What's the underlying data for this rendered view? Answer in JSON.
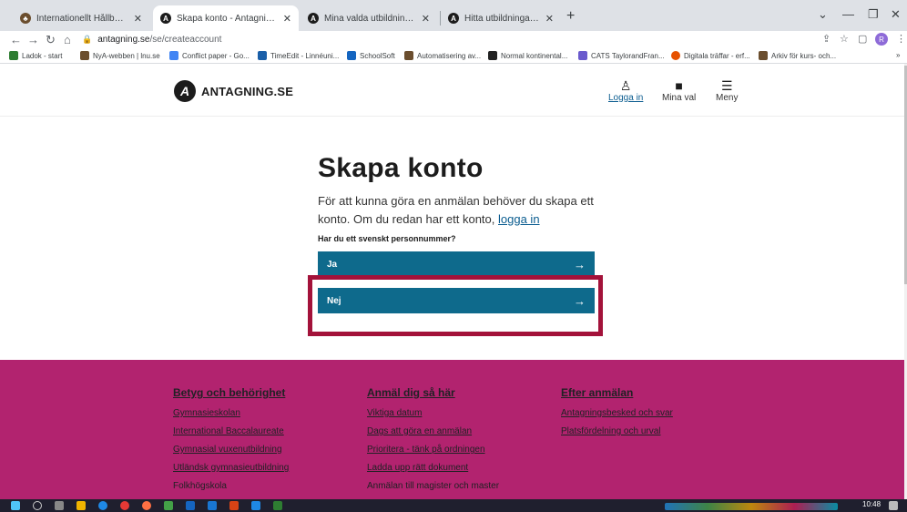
{
  "browser": {
    "tabs": [
      {
        "title": "Internationellt Hållbart familjeskog"
      },
      {
        "title": "Skapa konto - Antagning.se"
      },
      {
        "title": "Mina valda utbildningar - Antagning.se"
      },
      {
        "title": "Hitta utbildningar på Antagning.se"
      }
    ],
    "url_host": "antagning.se",
    "url_path": "/se/createaccount",
    "profile_initial": "R",
    "bookmarks": [
      "Ladok - start",
      "NyA-webben | lnu.se",
      "Conflict paper - Go...",
      "TimeEdit - Linnéuni...",
      "SchoolSoft",
      "Automatisering av...",
      "Normal kontinental...",
      "CATS TaylorandFran...",
      "Digitala träffar - erf...",
      "Arkiv för kurs- och..."
    ]
  },
  "header": {
    "logo_text": "ANTAGNING.SE",
    "logo_letter": "A",
    "login_label": "Logga in",
    "my_choices_label": "Mina val",
    "menu_label": "Meny"
  },
  "main": {
    "title": "Skapa konto",
    "lead_text": "För att kunna göra en anmälan behöver du skapa ett konto. Om du redan har ett konto, ",
    "lead_link": "logga in",
    "question": "Har du ett svenskt personnummer?",
    "yes_label": "Ja",
    "no_label": "Nej"
  },
  "footer": {
    "columns": [
      {
        "heading": "Betyg och behörighet",
        "links": [
          "Gymnasieskolan",
          "International Baccalaureate",
          "Gymnasial vuxenutbildning",
          "Utländsk gymnasieutbildning",
          "Folkhögskola"
        ]
      },
      {
        "heading": "Anmäl dig så här",
        "links": [
          "Viktiga datum",
          "Dags att göra en anmälan",
          "Prioritera - tänk på ordningen",
          "Ladda upp rätt dokument",
          "Anmälan till magister och master"
        ]
      },
      {
        "heading": "Efter anmälan",
        "links": [
          "Antagningsbesked och svar",
          "Platsfördelning och urval"
        ]
      }
    ]
  },
  "taskbar": {
    "clock": "10:48"
  }
}
